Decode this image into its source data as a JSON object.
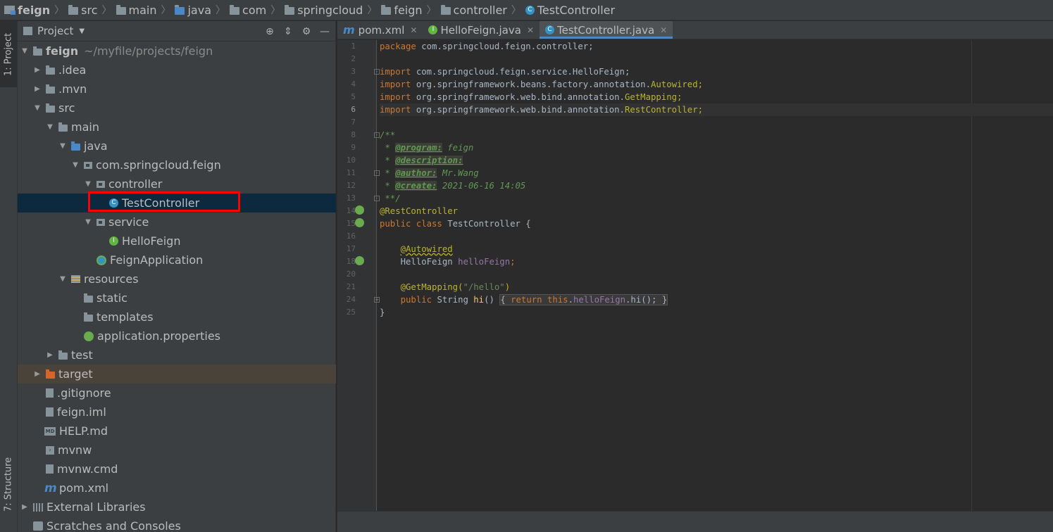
{
  "breadcrumb": [
    "feign",
    "src",
    "main",
    "java",
    "com",
    "springcloud",
    "feign",
    "controller",
    "TestController"
  ],
  "left_stripe": {
    "project_tab": "1: Project",
    "structure_tab": "7: Structure"
  },
  "project_panel": {
    "title": "Project",
    "tree": [
      {
        "label": "feign",
        "hint": "~/myfile/projects/feign"
      },
      {
        "label": ".idea"
      },
      {
        "label": ".mvn"
      },
      {
        "label": "src"
      },
      {
        "label": "main"
      },
      {
        "label": "java"
      },
      {
        "label": "com.springcloud.feign"
      },
      {
        "label": "controller"
      },
      {
        "label": "TestController"
      },
      {
        "label": "service"
      },
      {
        "label": "HelloFeign"
      },
      {
        "label": "FeignApplication"
      },
      {
        "label": "resources"
      },
      {
        "label": "static"
      },
      {
        "label": "templates"
      },
      {
        "label": "application.properties"
      },
      {
        "label": "test"
      },
      {
        "label": "target"
      },
      {
        "label": ".gitignore"
      },
      {
        "label": "feign.iml"
      },
      {
        "label": "HELP.md"
      },
      {
        "label": "mvnw"
      },
      {
        "label": "mvnw.cmd"
      },
      {
        "label": "pom.xml"
      },
      {
        "label": "External Libraries"
      },
      {
        "label": "Scratches and Consoles"
      }
    ]
  },
  "editor": {
    "tabs": [
      {
        "label": "pom.xml"
      },
      {
        "label": "HelloFeign.java"
      },
      {
        "label": "TestController.java"
      }
    ],
    "current_line": 6,
    "line_numbers": [
      "1",
      "2",
      "3",
      "4",
      "5",
      "6",
      "7",
      "8",
      "9",
      "10",
      "11",
      "12",
      "13",
      "14",
      "15",
      "16",
      "17",
      "18",
      "20",
      "21",
      "24",
      "25"
    ],
    "code": {
      "l1_kw": "package",
      "l1_rest": " com.springcloud.feign.controller;",
      "l3_kw": "import",
      "l3_rest": " com.springcloud.feign.service.HelloFeign;",
      "l4_kw": "import",
      "l4_rest": " org.springframework.beans.factory.annotation.",
      "l4_end": "Autowired;",
      "l5_kw": "import",
      "l5_rest": " org.springframework.web.bind.annotation.",
      "l5_end": "GetMapping;",
      "l6_kw": "import",
      "l6_rest": " org.springframework.web.bind.annotation.",
      "l6_end": "RestController;",
      "l8": "/**",
      "l9_star": " * ",
      "l9_tag": "@program:",
      "l9_val": " feign",
      "l10_star": " * ",
      "l10_tag": "@description:",
      "l11_star": " * ",
      "l11_tag": "@author:",
      "l11_val": " Mr.Wang",
      "l12_star": " * ",
      "l12_tag": "@create:",
      "l12_val": " 2021-06-16 14:05",
      "l13": " **/",
      "l14": "@RestController",
      "l15_kw": "public class",
      "l15_rest": " TestController {",
      "l17": "@Autowired",
      "l18_type": "HelloFeign ",
      "l18_field": "helloFeign",
      "l18_end": ";",
      "l20_ann": "@GetMapping(",
      "l20_str": "\"/hello\"",
      "l20_end": ")",
      "l21_kw": "public",
      "l21_type": " String ",
      "l21_meth": "hi",
      "l21_paren": "()",
      "l21_body_kw": "return this",
      "l21_dot": ".",
      "l21_field": "helloFeign",
      "l21_call": ".hi();",
      "l24": "}"
    }
  }
}
